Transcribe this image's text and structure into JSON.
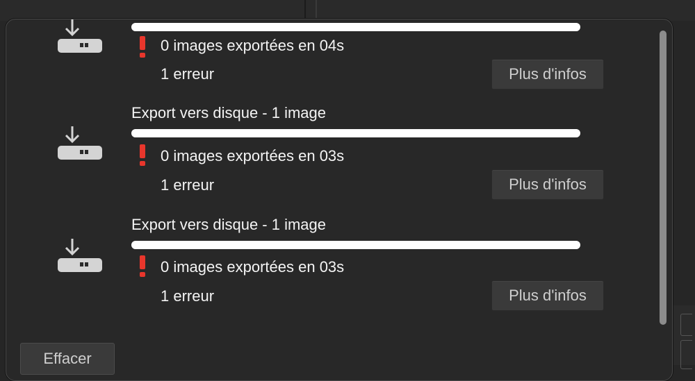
{
  "exports": [
    {
      "title": "",
      "progress": 1.0,
      "status": "0 images exportées en 04s",
      "errors": "1 erreur",
      "more_label": "Plus d'infos",
      "icon": "disk-export-icon",
      "warning_icon": "exclamation-icon"
    },
    {
      "title": "Export vers disque - 1 image",
      "progress": 1.0,
      "status": "0 images exportées en 03s",
      "errors": "1 erreur",
      "more_label": "Plus d'infos",
      "icon": "disk-export-icon",
      "warning_icon": "exclamation-icon"
    },
    {
      "title": "Export vers disque - 1 image",
      "progress": 1.0,
      "status": "0 images exportées en 03s",
      "errors": "1 erreur",
      "more_label": "Plus d'infos",
      "icon": "disk-export-icon",
      "warning_icon": "exclamation-icon"
    }
  ],
  "footer": {
    "clear_label": "Effacer"
  },
  "colors": {
    "warning": "#e8362c",
    "panel": "#282828",
    "text": "#f4f4f4"
  }
}
